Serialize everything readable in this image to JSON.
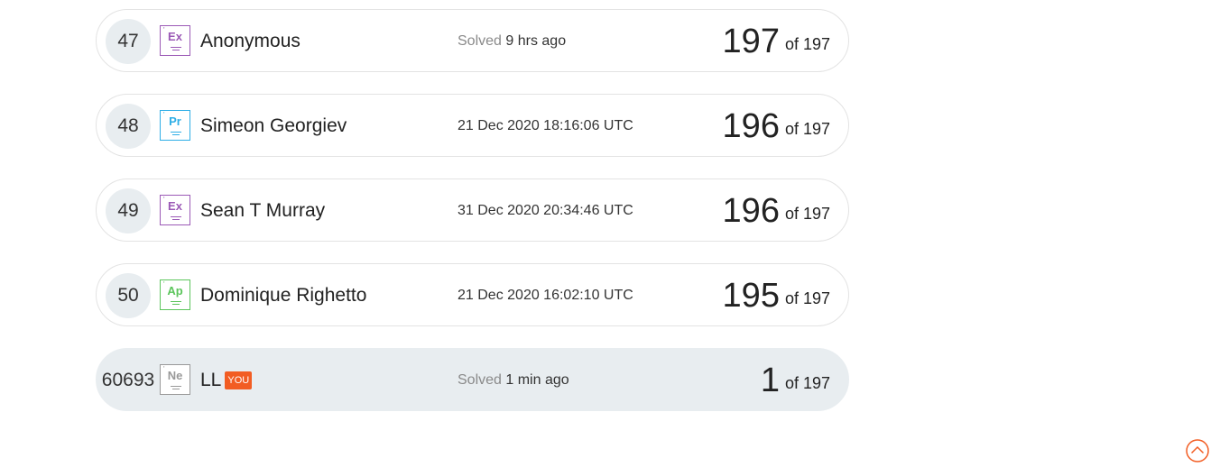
{
  "rows": [
    {
      "rank": "47",
      "badge": {
        "symbol": "Ex",
        "color": "#9b59b6"
      },
      "name": "Anonymous",
      "is_you": false,
      "date_prefix": "Solved",
      "date": "9 hrs ago",
      "score": "197",
      "of": "of 197"
    },
    {
      "rank": "48",
      "badge": {
        "symbol": "Pr",
        "color": "#2eaee6"
      },
      "name": "Simeon Georgiev",
      "is_you": false,
      "date_prefix": "",
      "date": "21 Dec 2020 18:16:06 UTC",
      "score": "196",
      "of": "of 197"
    },
    {
      "rank": "49",
      "badge": {
        "symbol": "Ex",
        "color": "#9b59b6"
      },
      "name": "Sean T Murray",
      "is_you": false,
      "date_prefix": "",
      "date": "31 Dec 2020 20:34:46 UTC",
      "score": "196",
      "of": "of 197"
    },
    {
      "rank": "50",
      "badge": {
        "symbol": "Ap",
        "color": "#5cc55c"
      },
      "name": "Dominique Righetto",
      "is_you": false,
      "date_prefix": "",
      "date": "21 Dec 2020 16:02:10 UTC",
      "score": "195",
      "of": "of 197"
    },
    {
      "rank": "60693",
      "badge": {
        "symbol": "Ne",
        "color": "#999999"
      },
      "name": "LL",
      "is_you": true,
      "you_label": "YOU",
      "date_prefix": "Solved",
      "date": "1 min ago",
      "score": "1",
      "of": "of 197"
    }
  ],
  "scroll_top": {
    "icon": "chevron-up-circle-icon",
    "color": "#f25d23"
  }
}
